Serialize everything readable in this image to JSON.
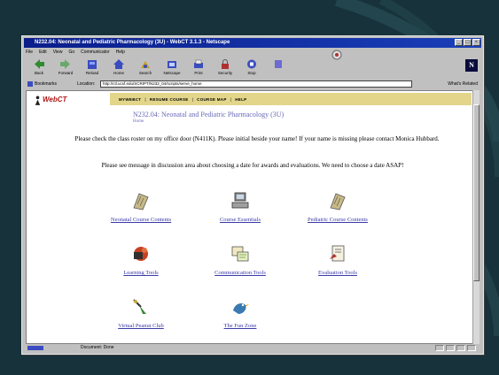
{
  "browser": {
    "title": "N232.04: Neonatal and Pediatric Pharmacology (3U) - WebCT 3.1.3 - Netscape",
    "menu": [
      "File",
      "Edit",
      "View",
      "Go",
      "Communicator",
      "Help"
    ],
    "toolbar": [
      "Back",
      "Forward",
      "Reload",
      "Home",
      "Search",
      "Netscape",
      "Print",
      "Security",
      "Stop"
    ],
    "bookmarks_label": "Bookmarks",
    "location_label": "Location:",
    "url": "http://ctl.ucsf.edu/SCRIPT/N232_04/scripts/serve_home",
    "related_label": "What's Related",
    "status": "Document: Done"
  },
  "page": {
    "logo": "WebCT",
    "nav": [
      "MYWEBCT",
      "RESUME COURSE",
      "COURSE MAP",
      "HELP"
    ],
    "course_title": "N232.04: Neonatal and Pediatric Pharmacology (3U)",
    "home_link": "Home",
    "notice1": "Please check the class roster on my office door (N411K). Please initial beside your name! If your name is missing please contact Monica Hubbard.",
    "notice2": "Please see message in discussion area about choosing a date for awards and evaluations. We need to choose a date ASAP!",
    "tools": [
      {
        "label": "Neonatal Course Contents",
        "icon": "book-icon"
      },
      {
        "label": "Course Essentials",
        "icon": "computer-icon"
      },
      {
        "label": "Pediatric Course Contents",
        "icon": "book-icon"
      },
      {
        "label": "Learning Tools",
        "icon": "toolbox-icon"
      },
      {
        "label": "Communication Tools",
        "icon": "messages-icon"
      },
      {
        "label": "Evaluation Tools",
        "icon": "evaluation-icon"
      },
      {
        "label": "Virtual Peanut Club",
        "icon": "pin-icon"
      },
      {
        "label": "The Fun Zone",
        "icon": "bird-icon"
      }
    ]
  },
  "colors": {
    "slide_bg": "#17323a",
    "nav_bar": "#e3d58a",
    "link": "#3a3aa8",
    "title_bar": "#0a1e8c"
  }
}
